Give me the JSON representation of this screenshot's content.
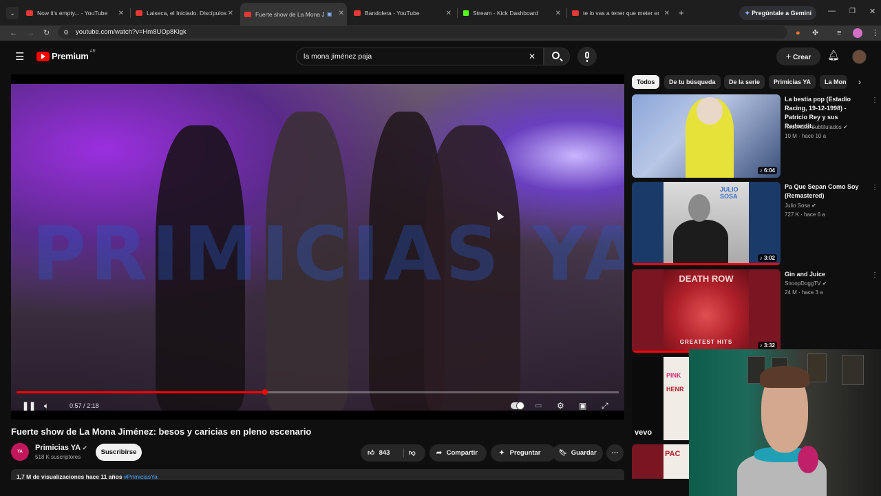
{
  "browser": {
    "tabs": [
      {
        "title": "Now it's empty... - YouTube",
        "kind": "youtube"
      },
      {
        "title": "Laiseca, el Iniciado. Discípulos",
        "kind": "youtube"
      },
      {
        "title": "Fuerte show de La Mona Jiménez",
        "kind": "youtube",
        "active": true
      },
      {
        "title": "Bandolera - YouTube",
        "kind": "youtube"
      },
      {
        "title": "Stream - Kick Dashboard",
        "kind": "kick"
      },
      {
        "title": "te lo vas a tener que meter en el",
        "kind": "youtube"
      }
    ],
    "new_tab": "+",
    "gemini_label": "Pregúntale a Gemini",
    "url": "youtube.com/watch?v=Hm8UOp8Klgk"
  },
  "youtube": {
    "logo_text": "Premium",
    "country": "AR",
    "search_query": "la mona jiménez paja",
    "create_label": "Crear"
  },
  "player": {
    "watermark": "PRIMICIAS YA",
    "time_current": "0:57",
    "time_total": "2:18",
    "progress_fraction": 0.413
  },
  "video": {
    "title": "Fuerte show de La Mona Jiménez: besos y caricias en pleno escenario",
    "channel": "Primicias YA",
    "channel_avatar_text": "YA",
    "subscribers": "518 K suscriptores",
    "subscribe_label": "Suscribirse",
    "likes": "843",
    "share_label": "Compartir",
    "ask_label": "Preguntar",
    "save_label": "Guardar",
    "views_line": "1,7 M de visualizaciones  hace 11 años",
    "hashtag": "#PrimiciasYa"
  },
  "chips": [
    "Todos",
    "De tu búsqueda",
    "De la serie",
    "Primicias YA",
    "La Mon"
  ],
  "recommendations": [
    {
      "title": "La bestia pop (Estadio Racing, 19-12-1998) - Patricio Rey y sus Redondit...",
      "channel": "Redondos Subtitulados",
      "meta": "10 M · hace 10 a",
      "duration": "6:04"
    },
    {
      "title": "Pa Que Sepan Como Soy (Remastered)",
      "channel": "Julio Sosa",
      "meta": "727 K · hace 6 a",
      "duration": "3:02",
      "thumb_text": "JULIO SOSA"
    },
    {
      "title": "Gin and Juice",
      "channel": "SnoopDoggTV",
      "meta": "24 M · hace 3 a",
      "duration": "3:32",
      "thumb_text": "DEATH ROW",
      "thumb_sub": "GREATEST HITS"
    },
    {
      "title": "",
      "channel": "",
      "meta": "",
      "duration": "",
      "thumb_text": "PINK",
      "thumb_sub": "HENR",
      "vevo": "vevo"
    },
    {
      "title": "",
      "channel": "",
      "meta": "",
      "duration": "",
      "thumb_text": "PAC"
    }
  ]
}
